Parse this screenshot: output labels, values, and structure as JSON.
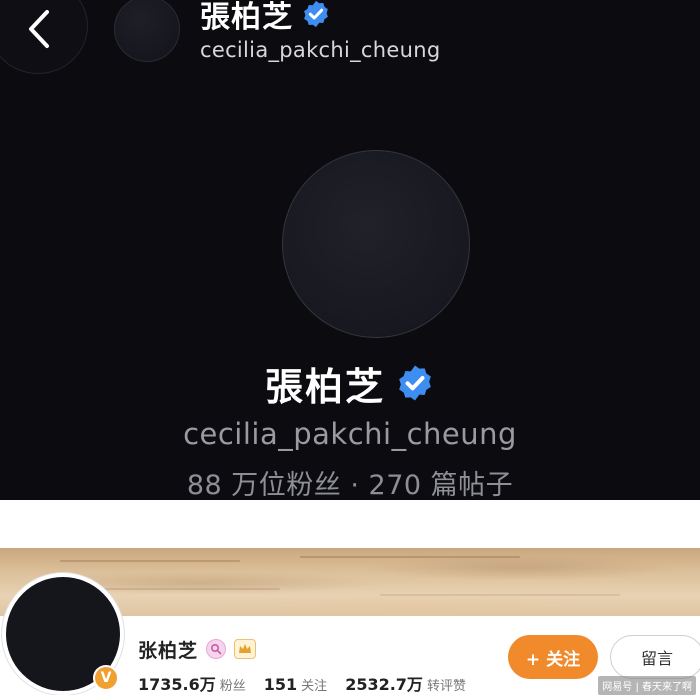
{
  "dark_profile": {
    "header": {
      "name": "張柏芝",
      "handle": "cecilia_pakchi_cheung"
    },
    "main": {
      "name": "張柏芝",
      "handle": "cecilia_pakchi_cheung",
      "stats": "88 万位粉丝 · 270 篇帖子"
    },
    "verified_color": "#3d8ef0"
  },
  "weibo_profile": {
    "name": "张柏芝",
    "verified_badge": "V",
    "stats": [
      {
        "value": "1735.6万",
        "label": "粉丝"
      },
      {
        "value": "151",
        "label": "关注"
      },
      {
        "value": "2532.7万",
        "label": "转评赞"
      }
    ],
    "follow_label": "+ 关注",
    "message_label": "留言",
    "accent_color": "#f08a2a",
    "watermark": "网易号 | 春天来了啊"
  }
}
